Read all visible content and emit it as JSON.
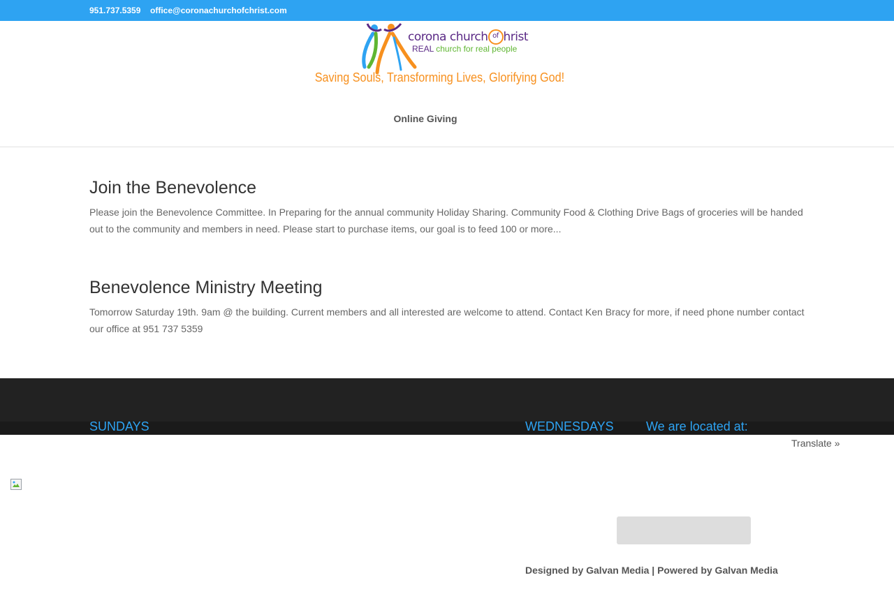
{
  "topbar": {
    "phone": "951.737.5359",
    "email": "office@coronachurchofchrist.com",
    "color": "#2ea3f2"
  },
  "logo": {
    "wordmark_prefix": "corona church",
    "wordmark_of": "of",
    "wordmark_suffix": "hrist",
    "subline_real": "REAL",
    "subline_rest": " church for real people"
  },
  "tagline": "Saving Souls, Transforming Lives, Glorifying God!",
  "nav": {
    "items": [
      {
        "label": "Online Giving"
      }
    ]
  },
  "posts": [
    {
      "title": "Join the Benevolence",
      "excerpt": "Please join the Benevolence Committee. In Preparing for the annual community Holiday Sharing. Community Food & Clothing Drive Bags of groceries will be handed out to the community and members in need. Please start to purchase items, our goal is to feed 100 or more..."
    },
    {
      "title": "Benevolence Ministry Meeting",
      "excerpt": "Tomorrow Saturday 19th. 9am @ the building. Current members and all interested are welcome to attend. Contact Ken Bracy for more, if need phone number contact our office at 951 737 5359"
    }
  ],
  "footer": {
    "sundays": "SUNDAYS",
    "wednesdays": "WEDNESDAYS",
    "location": "We are located at:",
    "translate": "Translate »",
    "credits": "Designed by Galvan Media | Powered by Galvan Media",
    "accent": "#2ea3f2"
  },
  "icons": {
    "logo": "people-celebrating-logo-icon",
    "broken_image": "broken-image-icon"
  }
}
